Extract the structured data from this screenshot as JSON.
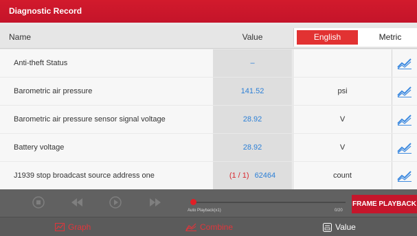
{
  "title": "Diagnostic Record",
  "header": {
    "name_label": "Name",
    "value_label": "Value",
    "unit_options": [
      "English",
      "Metric"
    ],
    "selected_unit": "English"
  },
  "rows": [
    {
      "name": "Anti-theft Status",
      "value": "–",
      "unit": ""
    },
    {
      "name": "Barometric air pressure",
      "value": "141.52",
      "unit": "psi"
    },
    {
      "name": "Barometric air pressure sensor signal voltage",
      "value": "28.92",
      "unit": "V"
    },
    {
      "name": "Battery voltage",
      "value": "28.92",
      "unit": "V"
    },
    {
      "name": "J1939 stop broadcast source address one",
      "frame": "(1 / 1)",
      "value": "62464",
      "unit": "count"
    }
  ],
  "player": {
    "mode": "Auto Playback(x1)",
    "position": "0/20",
    "frame_button": "FRAME PLAYBACK",
    "progress": 0
  },
  "tabs": {
    "graph": "Graph",
    "combine": "Combine",
    "value": "Value"
  },
  "colors": {
    "accent": "#c5162b",
    "value_text": "#2b7fd6",
    "chart_icon": "#3f8be0"
  }
}
